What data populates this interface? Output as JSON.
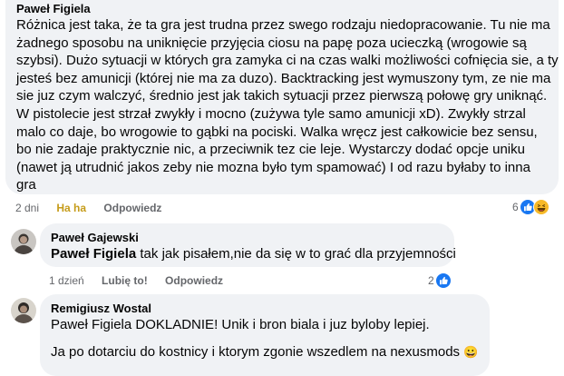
{
  "comment1": {
    "author": "Paweł Figiela",
    "lines": [
      "Różnica jest taka, że ta gra jest trudna przez swego rodzaju niedopracowanie. Tu nie ma",
      "żadnego sposobu na uniknięcie przyjęcia ciosu na papę poza ucieczką (wrogowie są",
      "szybsi). Dużo sytuacji w których gra zamyka ci na czas walki możliwości cofnięcia sie, a ty",
      "jesteś bez amunicji (której nie ma za duzo). Backtracking jest wymuszony tym, ze nie ma",
      "sie juz czym walczyć, średnio jest jak takich sytuacji przez pierwszą połowę gry uniknąć.",
      "W pistolecie jest strzał zwykły i mocno (zużywa tyle samo amunicji xD). Zwykły strzal",
      "malo co daje, bo wrogowie to gąbki na pociski. Walka wręcz jest całkowicie bez sensu,",
      "bo nie zadaje praktycznie nic, a przeciwnik tez cie leje. Wystarczy dodać opcje uniku",
      "(nawet ją utrudnić jakos zeby nie mozna było tym spamować) I od razu byłaby to inna",
      "gra"
    ],
    "time": "2 dni",
    "like_label": "Ha ha",
    "reply_label": "Odpowiedz",
    "reaction_count": "6"
  },
  "comment2": {
    "author": "Paweł Gajewski",
    "mention": "Paweł Figiela",
    "text": " tak jak pisałem,nie da się w to grać dla przyjemności",
    "time": "1 dzień",
    "like_label": "Lubię to!",
    "reply_label": "Odpowiedz",
    "reaction_count": "2"
  },
  "comment3": {
    "author": "Remigiusz Wostal",
    "line1": "Paweł Figiela DOKLADNIE! Unik i bron biala i juz byloby lepiej.",
    "line2": "Ja po dotarciu do kostnicy i ktorym zgonie wszedlem na nexusmods",
    "emoji": "😀"
  },
  "colors": {
    "bubble": "#f0f2f5",
    "meta": "#65676b",
    "like_blue": "#1877f2",
    "haha_yellow": "#f7b928"
  }
}
